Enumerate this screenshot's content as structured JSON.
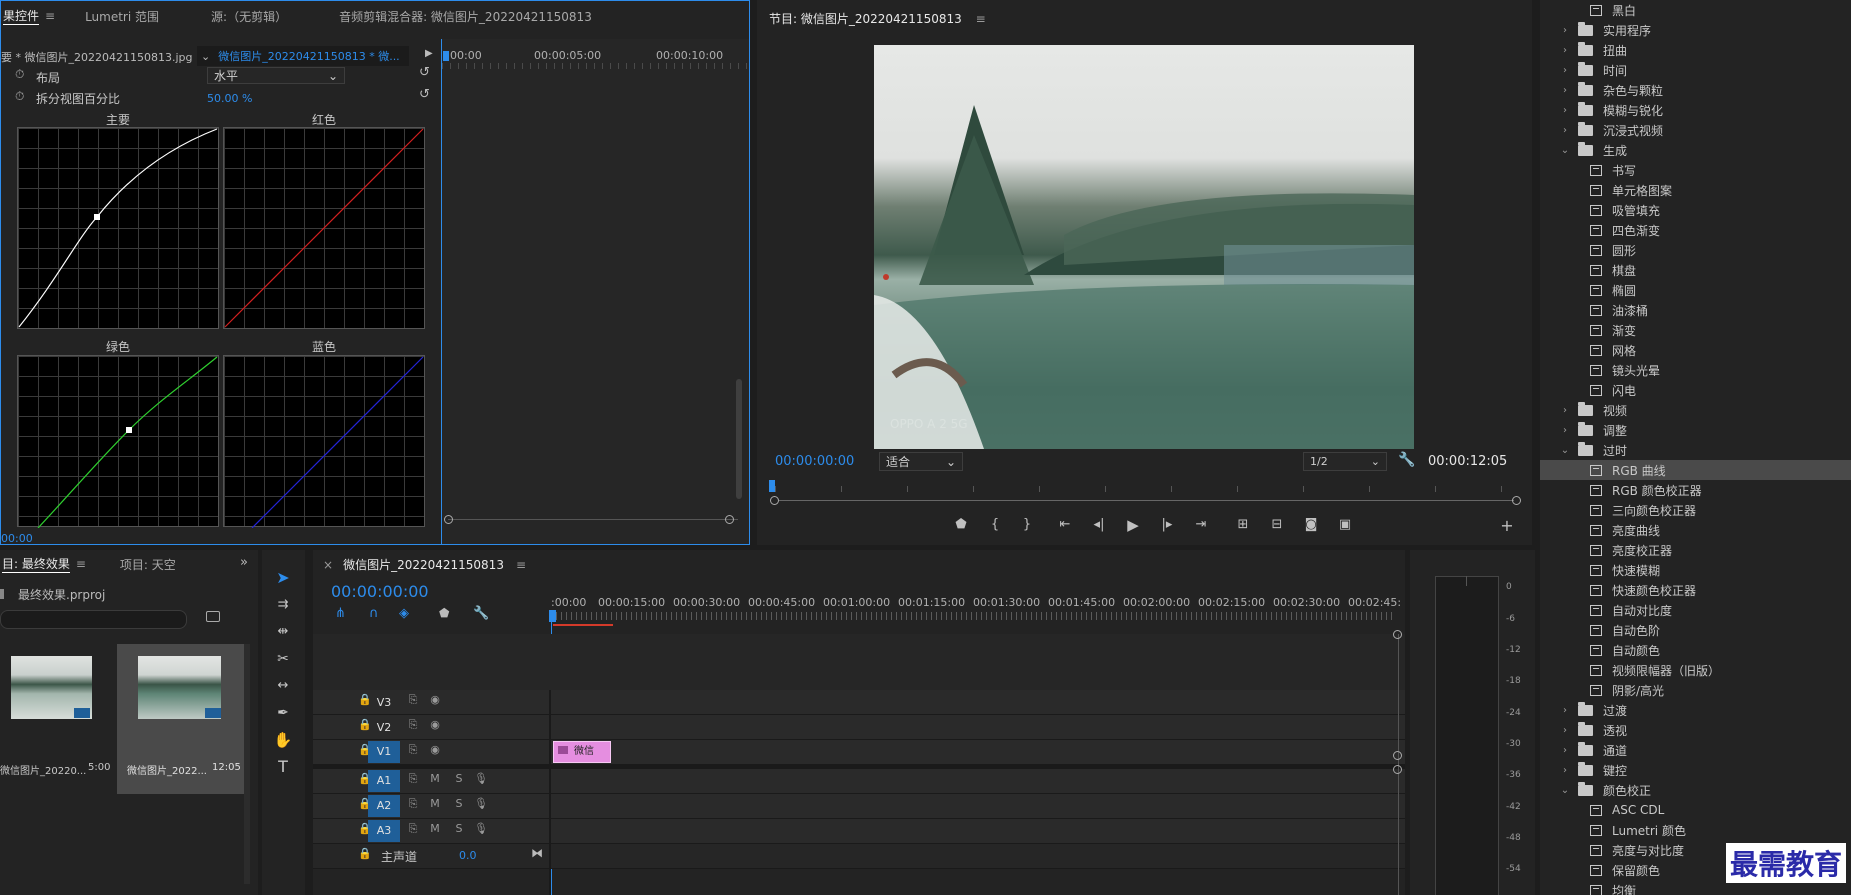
{
  "effect_controls": {
    "tabs": [
      {
        "label": "果控件",
        "active": true
      },
      {
        "label": "Lumetri 范围",
        "active": false
      },
      {
        "label": "源:（无剪辑）",
        "active": false
      },
      {
        "label": "音频剪辑混合器: 微信图片_20220421150813",
        "active": false
      }
    ],
    "clip_master": "要 * 微信图片_20220421150813.jpg",
    "clip_seq": "微信图片_20220421150813 * 微...",
    "mini_timecodes": [
      "00:00",
      "00:00:05:00",
      "00:00:10:00"
    ],
    "layout_label": "布局",
    "layout_value": "水平",
    "split_label": "拆分视图百分比",
    "split_value": "50.00 %",
    "curves": [
      {
        "title": "主要",
        "color": "#ffffff"
      },
      {
        "title": "红色",
        "color": "#d42020"
      },
      {
        "title": "绿色",
        "color": "#2fcf2f"
      },
      {
        "title": "蓝色",
        "color": "#2424d8"
      }
    ],
    "footer_time": "00:00"
  },
  "program_monitor": {
    "title": "节目: 微信图片_20220421150813",
    "timecode_left": "00:00:00:00",
    "fit_label": "适合",
    "quality": "1/2",
    "timecode_right": "00:00:12:05",
    "watermark": "OPPO A 2 5G"
  },
  "project": {
    "tabs": [
      {
        "label": "目: 最终效果",
        "active": true
      },
      {
        "label": "项目: 天空",
        "active": false
      }
    ],
    "file_name": "最终效果.prproj",
    "items": [
      {
        "name": "微信图片_20220...",
        "duration": "5:00",
        "selected": false
      },
      {
        "name": "微信图片_2022...",
        "duration": "12:05",
        "selected": true
      }
    ]
  },
  "timeline": {
    "title": "微信图片_20220421150813",
    "timecode": "00:00:00:00",
    "ruler": [
      ":00:00",
      "00:00:15:00",
      "00:00:30:00",
      "00:00:45:00",
      "00:01:00:00",
      "00:01:15:00",
      "00:01:30:00",
      "00:01:45:00",
      "00:02:00:00",
      "00:02:15:00",
      "00:02:30:00",
      "00:02:45:"
    ],
    "video_tracks": [
      "V3",
      "V2",
      "V1"
    ],
    "audio_tracks": [
      "A1",
      "A2",
      "A3"
    ],
    "master_label": "主声道",
    "master_value": "0.0",
    "clip_label": "微信",
    "mute_label": "M",
    "solo_label": "S"
  },
  "audio_meter": {
    "labels": [
      "0",
      "-6",
      "-12",
      "-18",
      "-24",
      "-30",
      "-36",
      "-42",
      "-48",
      "-54"
    ]
  },
  "effects_panel": {
    "items": [
      {
        "type": "fx",
        "label": "黑白",
        "selected": false
      },
      {
        "type": "folder",
        "label": "实用程序",
        "open": false
      },
      {
        "type": "folder",
        "label": "扭曲",
        "open": false
      },
      {
        "type": "folder",
        "label": "时间",
        "open": false
      },
      {
        "type": "folder",
        "label": "杂色与颗粒",
        "open": false
      },
      {
        "type": "folder",
        "label": "模糊与锐化",
        "open": false
      },
      {
        "type": "folder",
        "label": "沉浸式视频",
        "open": false
      },
      {
        "type": "folder",
        "label": "生成",
        "open": true
      },
      {
        "type": "fx",
        "label": "书写",
        "selected": false
      },
      {
        "type": "fx",
        "label": "单元格图案",
        "selected": false
      },
      {
        "type": "fx",
        "label": "吸管填充",
        "selected": false
      },
      {
        "type": "fx",
        "label": "四色渐变",
        "selected": false
      },
      {
        "type": "fx",
        "label": "圆形",
        "selected": false
      },
      {
        "type": "fx",
        "label": "棋盘",
        "selected": false
      },
      {
        "type": "fx",
        "label": "椭圆",
        "selected": false
      },
      {
        "type": "fx",
        "label": "油漆桶",
        "selected": false
      },
      {
        "type": "fx",
        "label": "渐变",
        "selected": false
      },
      {
        "type": "fx",
        "label": "网格",
        "selected": false
      },
      {
        "type": "fx",
        "label": "镜头光晕",
        "selected": false
      },
      {
        "type": "fx",
        "label": "闪电",
        "selected": false
      },
      {
        "type": "folder",
        "label": "视频",
        "open": false
      },
      {
        "type": "folder",
        "label": "调整",
        "open": false
      },
      {
        "type": "folder",
        "label": "过时",
        "open": true
      },
      {
        "type": "fx",
        "label": "RGB 曲线",
        "selected": true
      },
      {
        "type": "fx",
        "label": "RGB 颜色校正器",
        "selected": false
      },
      {
        "type": "fx",
        "label": "三向颜色校正器",
        "selected": false
      },
      {
        "type": "fx",
        "label": "亮度曲线",
        "selected": false
      },
      {
        "type": "fx",
        "label": "亮度校正器",
        "selected": false
      },
      {
        "type": "fx",
        "label": "快速模糊",
        "selected": false
      },
      {
        "type": "fx",
        "label": "快速颜色校正器",
        "selected": false
      },
      {
        "type": "fx",
        "label": "自动对比度",
        "selected": false
      },
      {
        "type": "fx",
        "label": "自动色阶",
        "selected": false
      },
      {
        "type": "fx",
        "label": "自动颜色",
        "selected": false
      },
      {
        "type": "fx",
        "label": "视频限幅器（旧版）",
        "selected": false
      },
      {
        "type": "fx",
        "label": "阴影/高光",
        "selected": false
      },
      {
        "type": "folder",
        "label": "过渡",
        "open": false
      },
      {
        "type": "folder",
        "label": "透视",
        "open": false
      },
      {
        "type": "folder",
        "label": "通道",
        "open": false
      },
      {
        "type": "folder",
        "label": "键控",
        "open": false
      },
      {
        "type": "folder",
        "label": "颜色校正",
        "open": true
      },
      {
        "type": "fx",
        "label": "ASC CDL",
        "selected": false
      },
      {
        "type": "fx",
        "label": "Lumetri 颜色",
        "selected": false
      },
      {
        "type": "fx",
        "label": "亮度与对比度",
        "selected": false
      },
      {
        "type": "fx",
        "label": "保留颜色",
        "selected": false
      },
      {
        "type": "fx",
        "label": "均衡",
        "selected": false
      }
    ]
  },
  "brand_watermark": "最需教育",
  "colors": {
    "accent": "#2d8ceb",
    "clip": "#e58ee0",
    "track_target": "#1f5f99",
    "selection": "#4a4a4a"
  }
}
